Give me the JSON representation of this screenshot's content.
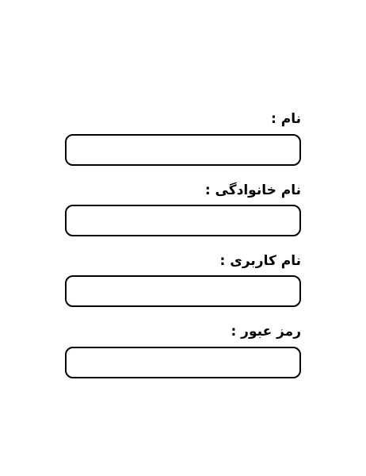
{
  "form": {
    "fields": [
      {
        "label": "نام :",
        "value": ""
      },
      {
        "label": "نام خانوادگی :",
        "value": ""
      },
      {
        "label": "نام کاربری :",
        "value": ""
      },
      {
        "label": "رمز عبور :",
        "value": ""
      }
    ]
  }
}
